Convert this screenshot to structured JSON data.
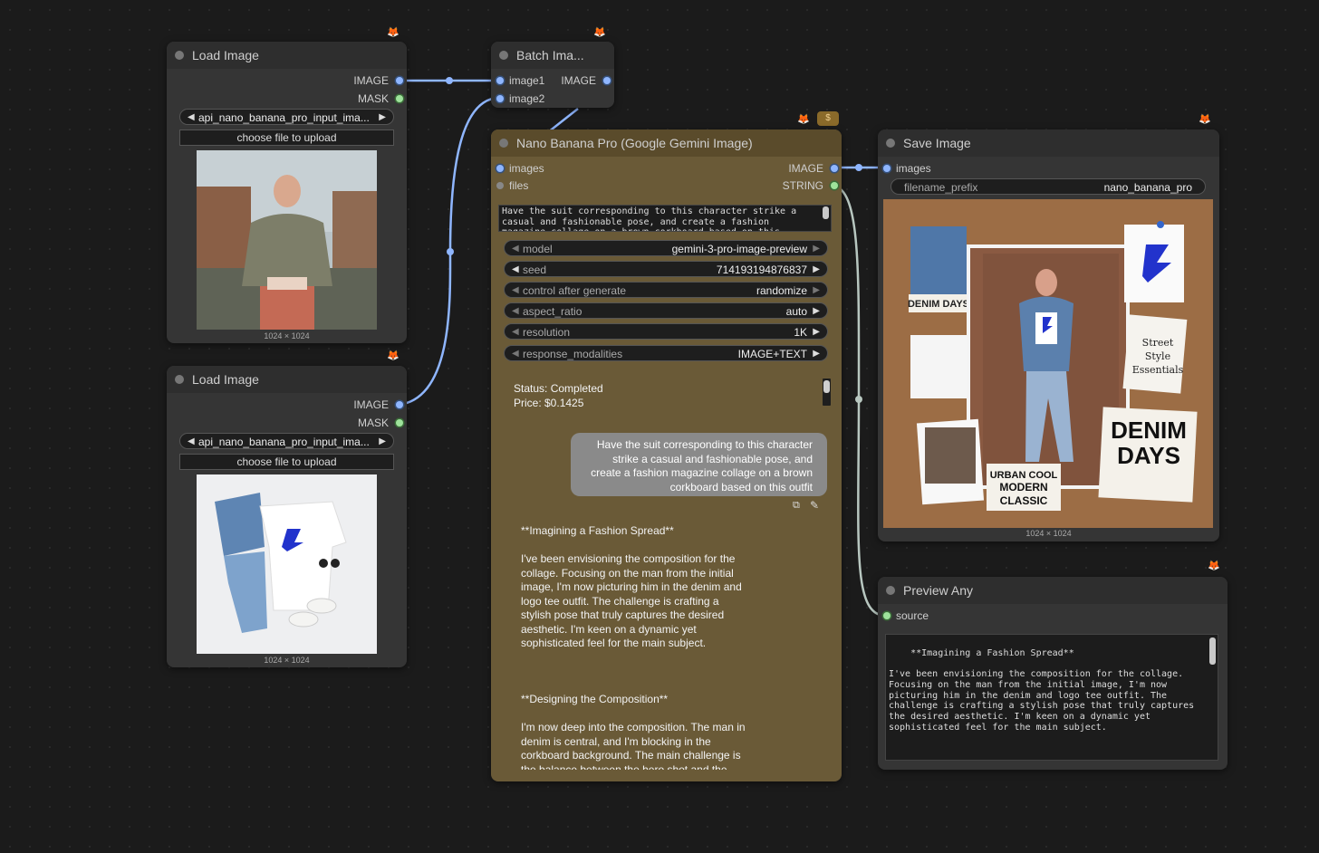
{
  "nodes": {
    "load_image_1": {
      "title": "Load Image",
      "outputs": [
        "IMAGE",
        "MASK"
      ],
      "image_file": "api_nano_banana_pro_input_ima...",
      "upload_label": "choose file to upload",
      "size": "1024 × 1024"
    },
    "load_image_2": {
      "title": "Load Image",
      "outputs": [
        "IMAGE",
        "MASK"
      ],
      "image_file": "api_nano_banana_pro_input_ima...",
      "upload_label": "choose file to upload",
      "size": "1024 × 1024"
    },
    "batch": {
      "title": "Batch Ima...",
      "inputs": [
        "image1",
        "image2"
      ],
      "outputs": [
        "IMAGE"
      ]
    },
    "nano": {
      "title": "Nano Banana Pro (Google Gemini Image)",
      "inputs": [
        "images",
        "files"
      ],
      "outputs": [
        "IMAGE",
        "STRING"
      ],
      "prompt": "Have the suit corresponding to this character strike a casual and fashionable pose, and create a fashion magazine collage on a brown corkboard based on this outfit",
      "widgets": [
        {
          "label": "model",
          "value": "gemini-3-pro-image-preview"
        },
        {
          "label": "seed",
          "value": "714193194876837"
        },
        {
          "label": "control after generate",
          "value": "randomize"
        },
        {
          "label": "aspect_ratio",
          "value": "auto"
        },
        {
          "label": "resolution",
          "value": "1K"
        },
        {
          "label": "response_modalities",
          "value": "IMAGE+TEXT"
        }
      ],
      "status": "Status: Completed",
      "price": "Price: $0.1425",
      "user_message": "Have the suit corresponding to this character strike a casual and fashionable pose, and create a fashion magazine collage on a brown corkboard based on this outfit",
      "reply_h1": "**Imagining a Fashion Spread**",
      "reply_p1": "I've been envisioning the composition for the collage. Focusing on the man from the initial image, I'm now picturing him in the denim and logo tee outfit. The challenge is crafting a stylish pose that truly captures the desired aesthetic. I'm keen on a dynamic yet sophisticated feel for the main subject.",
      "reply_h2": "**Designing the Composition**",
      "reply_p2": "I'm now deep into the composition. The man in denim is central, and I'm blocking in the corkboard background. The main challenge is the balance between the hero shot and the",
      "price_badge": "$"
    },
    "save": {
      "title": "Save Image",
      "inputs": [
        "images"
      ],
      "filename_prefix_label": "filename_prefix",
      "filename_prefix_value": "nano_banana_pro",
      "size": "1024 × 1024",
      "collage_text": {
        "denim_days_small": "DENIM DAYS",
        "street": "Street",
        "style": "Style",
        "essentials": "Essentials",
        "denim": "DENIM",
        "days": "DAYS",
        "urban_cool": "URBAN COOL",
        "modern": "MODERN",
        "classic": "CLASSIC"
      }
    },
    "preview": {
      "title": "Preview Any",
      "inputs": [
        "source"
      ],
      "text": "**Imagining a Fashion Spread**\n\nI've been envisioning the composition for the collage.\nFocusing on the man from the initial image, I'm now\npicturing him in the denim and logo tee outfit. The\nchallenge is crafting a stylish pose that truly captures\nthe desired aesthetic. I'm keen on a dynamic yet\nsophisticated feel for the main subject.\n\n\n\n**Designing the Composition**"
    }
  },
  "colors": {
    "canvas": "#1b1b1b",
    "node": "#353535",
    "nano_node": "#6a5a37",
    "image_wire": "#8fb6ff",
    "string_wire": "#b8c7c0"
  }
}
